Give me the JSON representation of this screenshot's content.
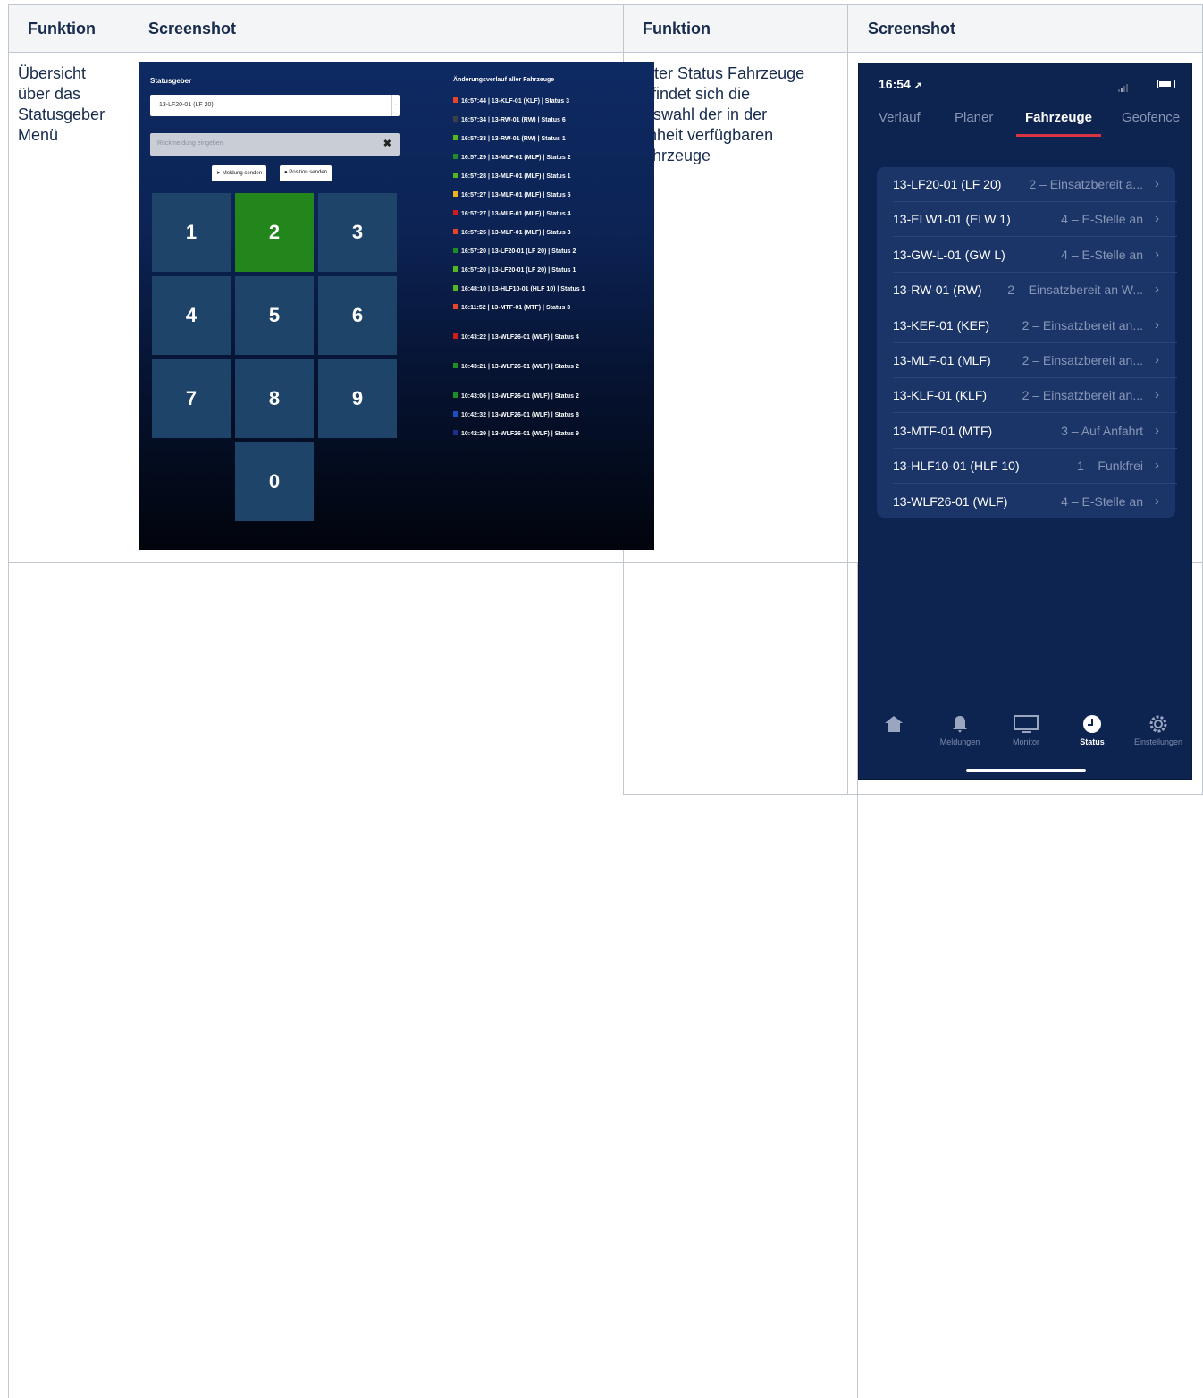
{
  "table": {
    "headers": [
      "Funktion",
      "Screenshot",
      "Funktion",
      "Screenshot"
    ],
    "row1_col1": [
      "Übersicht",
      "über das",
      "Statusgeber",
      "Menü"
    ],
    "row1_col3": [
      "Unter Status  Fahrzeuge",
      "befindet sich die",
      "Auswahl der in der",
      "Einheit verfügbaren",
      "Fahrzeuge"
    ]
  },
  "statusgeber": {
    "title": "Statusgeber",
    "selected_vehicle": "13-LF20-01 (LF 20)",
    "message_placeholder": "Rückmeldung eingeben",
    "send_message_label": "Meldung senden",
    "send_position_label": "Position senden",
    "keys": [
      "1",
      "2",
      "3",
      "4",
      "5",
      "6",
      "7",
      "8",
      "9",
      "0"
    ],
    "active_key": "2",
    "history_title": "Änderungsverlauf aller Fahrzeuge",
    "history": [
      {
        "color": "#e8432b",
        "text": "16:57:44 | 13-KLF-01 (KLF) | Status 3"
      },
      {
        "color": "#3e4048",
        "text": "16:57:34 | 13-RW-01 (RW) | Status 6"
      },
      {
        "color": "#52b81e",
        "text": "16:57:33 | 13-RW-01 (RW) | Status 1"
      },
      {
        "color": "#1d8d25",
        "text": "16:57:29 | 13-MLF-01 (MLF) | Status 2"
      },
      {
        "color": "#52b81e",
        "text": "16:57:28 | 13-MLF-01 (MLF) | Status 1"
      },
      {
        "color": "#f0b21a",
        "text": "16:57:27 | 13-MLF-01 (MLF) | Status 5"
      },
      {
        "color": "#d61a1a",
        "text": "16:57:27 | 13-MLF-01 (MLF) | Status 4"
      },
      {
        "color": "#e8432b",
        "text": "16:57:25 | 13-MLF-01 (MLF) | Status 3"
      },
      {
        "color": "#1d8d25",
        "text": "16:57:20 | 13-LF20-01 (LF 20) | Status 2"
      },
      {
        "color": "#52b81e",
        "text": "16:57:20 | 13-LF20-01 (LF 20) | Status 1"
      },
      {
        "color": "#52b81e",
        "text": "16:48:10 | 13-HLF10-01 (HLF 10) | Status 1"
      },
      {
        "color": "#e8432b",
        "text": "16:11:52 | 13-MTF-01 (MTF) | Status 3"
      },
      {
        "color": "#d61a1a",
        "text": "10:43:22 | 13-WLF26-01 (WLF) | Status 4"
      },
      {
        "color": "#1d8d25",
        "text": "10:43:21 | 13-WLF26-01 (WLF) | Status 2"
      },
      {
        "color": "#1d8d25",
        "text": "10:43:06 | 13-WLF26-01 (WLF) | Status 2"
      },
      {
        "color": "#1c4fc2",
        "text": "10:42:32 | 13-WLF26-01 (WLF) | Status 8"
      },
      {
        "color": "#1c2f8a",
        "text": "10:42:29 | 13-WLF26-01 (WLF) | Status 9"
      }
    ]
  },
  "mobile": {
    "time": "16:54",
    "tabs": [
      "Verlauf",
      "Planer",
      "Fahrzeuge",
      "Geofence"
    ],
    "active_tab": "Fahrzeuge",
    "vehicles": [
      {
        "name": "13-LF20-01 (LF 20)",
        "status": "2 – Einsatzbereit a..."
      },
      {
        "name": "13-ELW1-01 (ELW 1)",
        "status": "4 – E-Stelle an"
      },
      {
        "name": "13-GW-L-01 (GW L)",
        "status": "4 – E-Stelle an"
      },
      {
        "name": "13-RW-01 (RW)",
        "status": "2 – Einsatzbereit an W..."
      },
      {
        "name": "13-KEF-01 (KEF)",
        "status": "2 – Einsatzbereit an..."
      },
      {
        "name": "13-MLF-01 (MLF)",
        "status": "2 – Einsatzbereit an..."
      },
      {
        "name": "13-KLF-01 (KLF)",
        "status": "2 – Einsatzbereit an..."
      },
      {
        "name": "13-MTF-01 (MTF)",
        "status": "3 – Auf Anfahrt"
      },
      {
        "name": "13-HLF10-01 (HLF 10)",
        "status": "1 – Funkfrei"
      },
      {
        "name": "13-WLF26-01 (WLF)",
        "status": "4 – E-Stelle an"
      }
    ],
    "nav": [
      {
        "icon": "home-icon",
        "label": ""
      },
      {
        "icon": "bell-icon",
        "label": "Meldungen"
      },
      {
        "icon": "monitor-icon",
        "label": "Monitor"
      },
      {
        "icon": "clock-icon",
        "label": "Status"
      },
      {
        "icon": "gear-icon",
        "label": "Einstellungen"
      }
    ],
    "active_nav": "Status"
  }
}
